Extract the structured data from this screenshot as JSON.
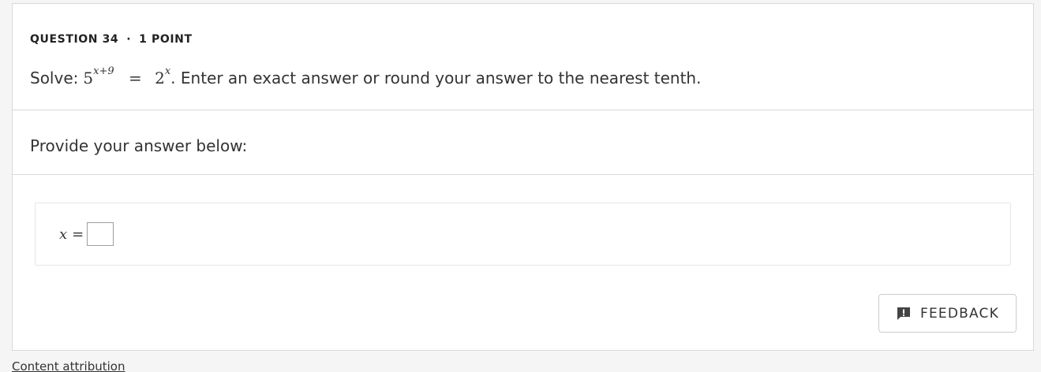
{
  "question": {
    "number_label": "QUESTION 34",
    "separator": "·",
    "points_label": "1 POINT",
    "prefix": "Solve:",
    "equation": {
      "base_left": "5",
      "exponent_left": "x+9",
      "equals": "=",
      "base_right": "2",
      "exponent_right": "x"
    },
    "instruction": ". Enter an exact answer or round your answer to the nearest tenth."
  },
  "prompt": {
    "text": "Provide your answer below:"
  },
  "answer": {
    "variable": "x",
    "equals": "=",
    "value": ""
  },
  "feedback": {
    "label": "FEEDBACK",
    "icon": "feedback-alert-icon"
  },
  "footer": {
    "attribution": "Content attribution"
  }
}
